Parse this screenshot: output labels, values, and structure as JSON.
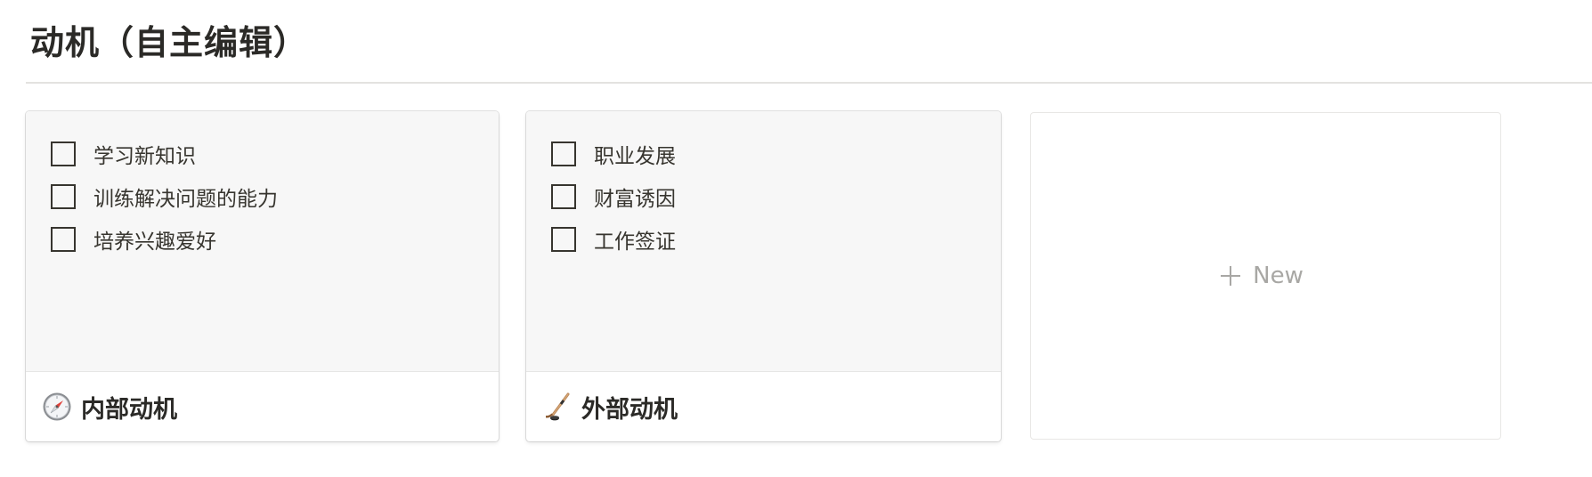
{
  "page": {
    "title": "动机（自主编辑）"
  },
  "gallery": {
    "cards": [
      {
        "title": "内部动机",
        "icon": "compass-icon",
        "todos": [
          {
            "label": "学习新知识",
            "checked": false
          },
          {
            "label": "训练解决问题的能力",
            "checked": false
          },
          {
            "label": "培养兴趣爱好",
            "checked": false
          }
        ]
      },
      {
        "title": "外部动机",
        "icon": "ice-hockey-icon",
        "todos": [
          {
            "label": "职业发展",
            "checked": false
          },
          {
            "label": "财富诱因",
            "checked": false
          },
          {
            "label": "工作签证",
            "checked": false
          }
        ]
      }
    ],
    "new_label": "New"
  },
  "colors": {
    "text": "#37352f",
    "preview_bg": "#f7f7f7",
    "muted": "#a8a7a4"
  }
}
